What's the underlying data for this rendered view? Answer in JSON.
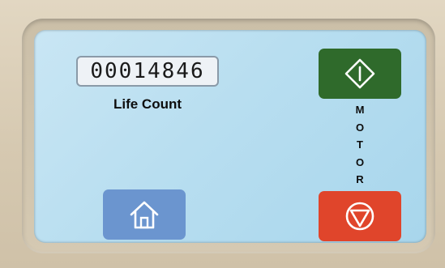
{
  "counter": {
    "value": "00014846",
    "label": "Life Count"
  },
  "motor": {
    "letters": [
      "M",
      "O",
      "T",
      "O",
      "R"
    ],
    "start_icon": "start-diamond-icon",
    "stop_icon": "stop-triangle-circle-icon"
  },
  "home": {
    "icon": "home-icon"
  },
  "colors": {
    "start": "#2f6a2b",
    "stop": "#e0452b",
    "home": "#6b95cf",
    "screen": "#b8def0",
    "bezel": "#d8ccb5"
  }
}
